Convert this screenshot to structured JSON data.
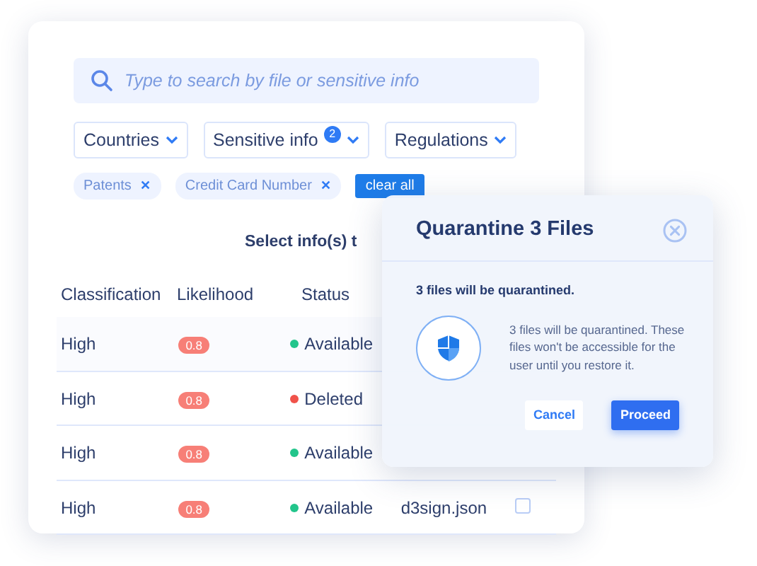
{
  "search": {
    "placeholder": "Type to search by file or sensitive info"
  },
  "filters": [
    {
      "label": "Countries"
    },
    {
      "label": "Sensitive info",
      "count": "2"
    },
    {
      "label": "Regulations"
    }
  ],
  "tags": [
    {
      "label": "Patents",
      "remove": "✕"
    },
    {
      "label": "Credit Card Number",
      "remove": "✕"
    }
  ],
  "clear_button": "clear all",
  "table": {
    "title": "Select info(s) t",
    "columns": [
      "Classification",
      "Likelihood",
      "Status"
    ],
    "rows": [
      {
        "classification": "High",
        "likelihood": "0.8",
        "status": "Available",
        "color": "#22c58b"
      },
      {
        "classification": "High",
        "likelihood": "0.8",
        "status": "Deleted",
        "color": "#f0524a"
      },
      {
        "classification": "High",
        "likelihood": "0.8",
        "status": "Available",
        "color": "#22c58b"
      },
      {
        "classification": "High",
        "likelihood": "0.8",
        "status": "Available",
        "color": "#22c58b",
        "file": "d3sign.json",
        "checked": false
      }
    ]
  },
  "dialog": {
    "title": "Quarantine 3 Files",
    "subtitle": "3 files will be quarantined.",
    "message": "3 files will be quarantined. These files won't be accessible for the user until you restore it.",
    "buttons": [
      {
        "label": "Cancel",
        "kind": "secondary"
      },
      {
        "label": "Proceed",
        "kind": "primary"
      }
    ]
  }
}
